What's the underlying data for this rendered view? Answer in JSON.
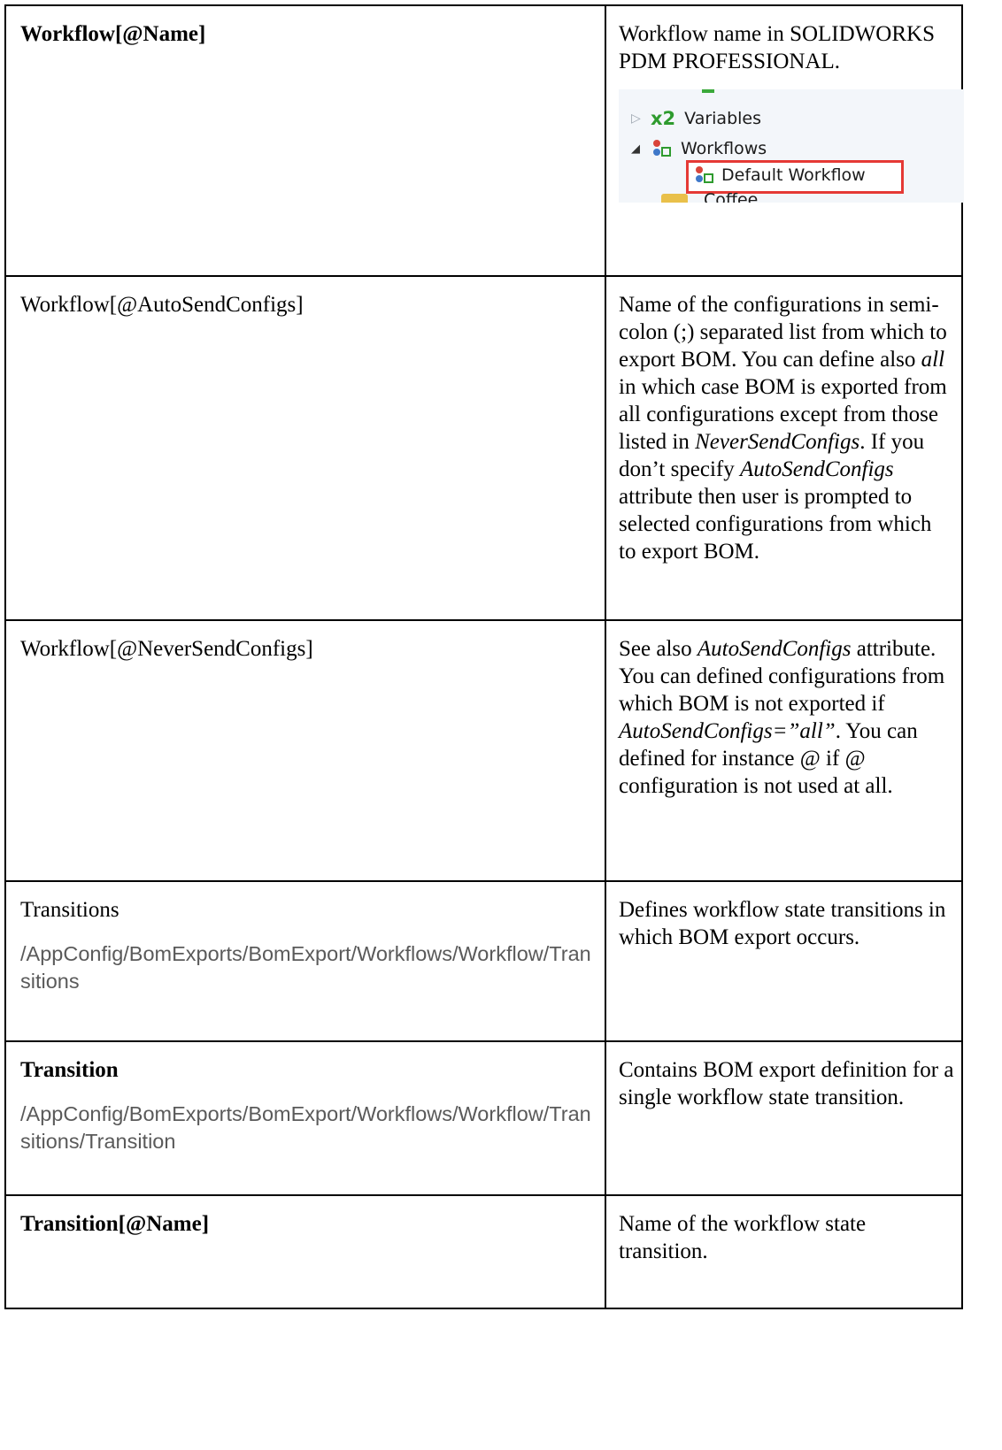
{
  "rows": [
    {
      "term": "Workflow[@Name]",
      "bold": true,
      "desc_parts": [
        {
          "text": "Workflow name in SOLIDWORKS PDM PROFESSIONAL.",
          "italic": false
        }
      ],
      "screenshot": {
        "items": [
          {
            "label": "Variables",
            "glyph": "x2"
          },
          {
            "label": "Workflows"
          },
          {
            "label": "Default Workflow"
          }
        ],
        "partial_label": "Coffee"
      }
    },
    {
      "term": "Workflow[@AutoSendConfigs]",
      "bold": false,
      "desc_parts": [
        {
          "text": "Name of the configurations in semi-colon (;) separated list from which to export BOM. You can define also ",
          "italic": false
        },
        {
          "text": "all",
          "italic": true
        },
        {
          "text": " in which case BOM is exported from all configurations except from those listed in ",
          "italic": false
        },
        {
          "text": "NeverSendConfigs",
          "italic": true
        },
        {
          "text": ". If you don’t specify ",
          "italic": false
        },
        {
          "text": "AutoSendConfigs",
          "italic": true
        },
        {
          "text": " attribute then user is prompted to selected configurations from which to export BOM.",
          "italic": false
        }
      ]
    },
    {
      "term": "Workflow[@NeverSendConfigs]",
      "bold": false,
      "desc_parts": [
        {
          "text": "See also ",
          "italic": false
        },
        {
          "text": "AutoSendConfigs",
          "italic": true
        },
        {
          "text": " attribute. You can defined configurations from which BOM is not exported if ",
          "italic": false
        },
        {
          "text": "AutoSendConfigs=”all”",
          "italic": true
        },
        {
          "text": ". You can defined for instance @ if @ configuration is not used at all.",
          "italic": false
        }
      ]
    },
    {
      "term": "Transitions",
      "bold": false,
      "path": "/AppConfig/BomExports/BomExport/Workflows/Workflow/Transitions",
      "desc_parts": [
        {
          "text": "Defines workflow state transitions in which BOM export occurs.",
          "italic": false
        }
      ]
    },
    {
      "term": "Transition",
      "bold": true,
      "path": "/AppConfig/BomExports/BomExport/Workflows/Workflow/Transitions/Transition",
      "desc_parts": [
        {
          "text": "Contains BOM export definition for a single workflow state transition.",
          "italic": false
        }
      ]
    },
    {
      "term": "Transition[@Name]",
      "bold": true,
      "desc_parts": [
        {
          "text": "Name of the workflow state transition.",
          "italic": false
        }
      ]
    }
  ]
}
